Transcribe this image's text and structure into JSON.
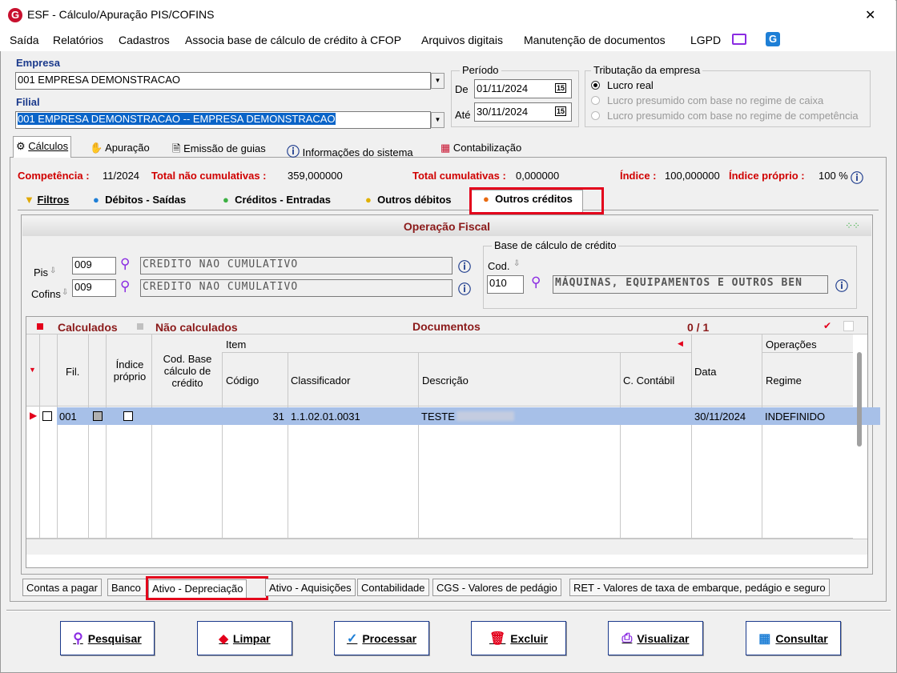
{
  "window": {
    "title": "ESF - Cálculo/Apuração PIS/COFINS",
    "close": "✕"
  },
  "menu": [
    "Saída",
    "Relatórios",
    "Cadastros",
    "Associa base de cálculo de crédito à CFOP",
    "Arquivos digitais",
    "Manutenção de documentos",
    "LGPD"
  ],
  "empresa": {
    "label": "Empresa",
    "value": "001 EMPRESA DEMONSTRACAO"
  },
  "filial": {
    "label": "Filial",
    "value": "001 EMPRESA DEMONSTRACAO -- EMPRESA DEMONSTRACAO"
  },
  "periodo": {
    "label": "Período",
    "de_label": "De",
    "de": "01/11/2024",
    "ate_label": "Até",
    "ate": "30/11/2024",
    "cal": "15"
  },
  "tributacao": {
    "label": "Tributação da empresa",
    "options": [
      "Lucro real",
      "Lucro presumido com base no regime de caixa",
      "Lucro presumido com base no regime de competência"
    ],
    "selected": "Lucro real"
  },
  "main_tabs": [
    "Cálculos",
    "Apuração",
    "Emissão de guias",
    "Informações do sistema",
    "Contabilização"
  ],
  "summary": {
    "competencia_label": "Competência :",
    "competencia": "11/2024",
    "nao_cum_label": "Total não cumulativas :",
    "nao_cum": "359,000000",
    "cum_label": "Total cumulativas :",
    "cum": "0,000000",
    "indice_label": "Índice :",
    "indice": "100,000000",
    "indice_proprio_label": "Índice próprio :",
    "indice_proprio": "100 %"
  },
  "sub_tabs": [
    "Filtros",
    "Débitos - Saídas",
    "Créditos - Entradas",
    "Outros débitos",
    "Outros créditos"
  ],
  "operacao": {
    "title": "Operação Fiscal",
    "pis_label": "Pis",
    "pis_code": "009",
    "pis_desc": "CREDITO NAO CUMULATIVO",
    "cofins_label": "Cofins",
    "cofins_code": "009",
    "cofins_desc": "CREDITO NAO CUMULATIVO",
    "base_label": "Base de cálculo de crédito",
    "cod_label": "Cod.",
    "cod": "010",
    "cod_desc": "MÁQUINAS, EQUIPAMENTOS E OUTROS BEN"
  },
  "grid": {
    "legend_calc": "Calculados",
    "legend_nao": "Não calculados",
    "title": "Documentos",
    "count": "0 / 1",
    "h_fil": "Fil.",
    "h_indice": "Índice próprio",
    "h_cod_base": "Cod. Base cálculo de crédito",
    "h_item": "Item",
    "h_codigo": "Código",
    "h_classif": "Classificador",
    "h_desc": "Descrição",
    "h_conta": "C. Contábil",
    "h_data": "Data",
    "h_ops": "Operações",
    "h_regime": "Regime",
    "rows": [
      {
        "fil": "001",
        "codigo": "31",
        "classificador": "1.1.02.01.0031",
        "descricao": "TESTE",
        "data": "30/11/2024",
        "regime": "INDEFINIDO"
      }
    ]
  },
  "bottom_tabs": [
    "Contas a pagar",
    "Banco",
    "Ativo - Depreciação",
    "Ativo - Aquisições",
    "Contabilidade",
    "CGS - Valores de pedágio",
    "RET - Valores de taxa de embarque, pedágio e seguro"
  ],
  "buttons": [
    "Pesquisar",
    "Limpar",
    "Processar",
    "Excluir",
    "Visualizar",
    "Consultar"
  ],
  "colors": {
    "accent": "#1b3a8c",
    "highlight": "#e3001b",
    "selection": "#a7c0e8"
  }
}
